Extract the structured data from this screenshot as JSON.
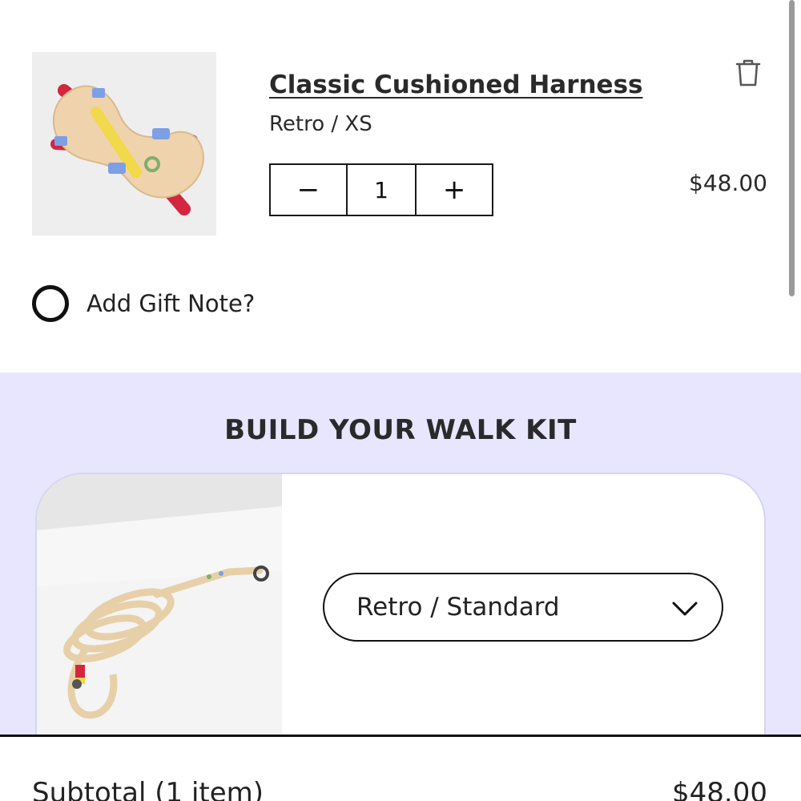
{
  "cart_item": {
    "title": "Classic Cushioned Harness",
    "variant": "Retro / XS",
    "quantity": "1",
    "decrement_symbol": "−",
    "increment_symbol": "+",
    "price": "$48.00",
    "remove_icon": "trash-icon"
  },
  "gift_note": {
    "label": "Add Gift Note?",
    "checked": false
  },
  "walk_kit": {
    "heading": "BUILD YOUR WALK KIT",
    "selected_option": "Retro / Standard",
    "select_icon": "chevron-down-icon"
  },
  "summary": {
    "subtotal_label": "Subtotal (1 item)",
    "subtotal_value": "$48.00"
  },
  "colors": {
    "lavender_bg": "#e8e6ff",
    "harness_tan": "#efd3ad",
    "harness_red": "#d4263f",
    "harness_yellow": "#f2d84b",
    "harness_blue": "#7d9fe6"
  }
}
